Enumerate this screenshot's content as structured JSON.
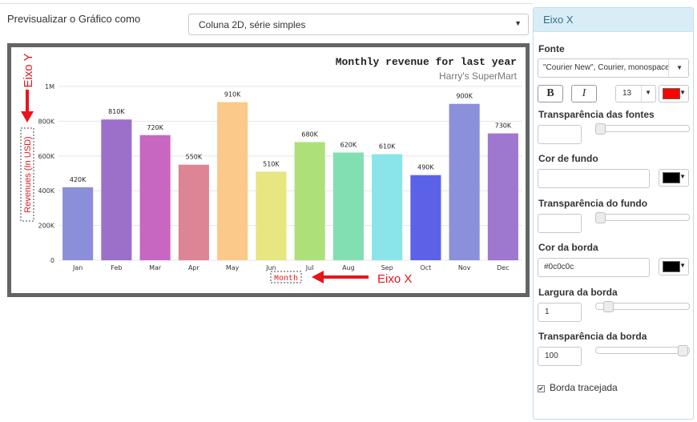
{
  "toolbar": {
    "preview_label": "Previsualizar o Gráfico como",
    "chart_type_value": "Coluna 2D, série simples"
  },
  "chart": {
    "title": "Monthly revenue for last year",
    "subtitle": "Harry's SuperMart",
    "ylabel": "Revenues (In USD)",
    "xlabel": "Month",
    "annotation_y": "Eixo Y",
    "annotation_x": "Eixo X"
  },
  "chart_data": {
    "type": "bar",
    "title": "Monthly revenue for last year",
    "subtitle": "Harry's SuperMart",
    "xlabel": "Month",
    "ylabel": "Revenues (In USD)",
    "categories": [
      "Jan",
      "Feb",
      "Mar",
      "Apr",
      "May",
      "Jun",
      "Jul",
      "Aug",
      "Sep",
      "Oct",
      "Nov",
      "Dec"
    ],
    "values": [
      420000,
      810000,
      720000,
      550000,
      910000,
      510000,
      680000,
      620000,
      610000,
      490000,
      900000,
      730000
    ],
    "value_labels": [
      "420K",
      "810K",
      "720K",
      "550K",
      "910K",
      "510K",
      "680K",
      "620K",
      "610K",
      "490K",
      "900K",
      "730K"
    ],
    "colors": [
      "#8b8ed8",
      "#9c70c9",
      "#c767c2",
      "#dd8495",
      "#fbc98a",
      "#e7e681",
      "#aee07a",
      "#82dfb1",
      "#89e5e9",
      "#5b62e8",
      "#8a90da",
      "#9e77cf"
    ],
    "ylim": [
      0,
      1000000
    ],
    "yticks": [
      0,
      200000,
      400000,
      600000,
      800000,
      1000000
    ],
    "ytick_labels": [
      "0",
      "200K",
      "400K",
      "600K",
      "800K",
      "1M"
    ],
    "grid": true,
    "legend": "none"
  },
  "panel": {
    "header": "Eixo X",
    "font_label": "Fonte",
    "font_value": "\"Courier New\", Courier, monospace",
    "bold_label": "B",
    "italic_label": "I",
    "font_size_value": "13",
    "font_color": "#ff0000",
    "font_transparency_label": "Transparência das fontes",
    "font_transparency_value": "",
    "font_transparency_level": 0,
    "bg_color_label": "Cor de fundo",
    "bg_color_value": "",
    "bg_swatch": "#000000",
    "bg_transparency_label": "Transparência do fundo",
    "bg_transparency_value": "",
    "bg_transparency_level": 0,
    "border_color_label": "Cor da borda",
    "border_color_value": "#0c0c0c",
    "border_swatch": "#000000",
    "border_width_label": "Largura da borda",
    "border_width_value": "1",
    "border_width_level": 0.1,
    "border_transparency_label": "Transparência da borda",
    "border_transparency_value": "100",
    "border_transparency_level": 1,
    "dashed_border_label": "Borda tracejada",
    "dashed_border_checked": "✔"
  },
  "colors": {
    "annotation_red": "#e8141c",
    "frame": "#646464",
    "panel_header_bg": "#d9edf7",
    "panel_header_text": "#31708f"
  }
}
